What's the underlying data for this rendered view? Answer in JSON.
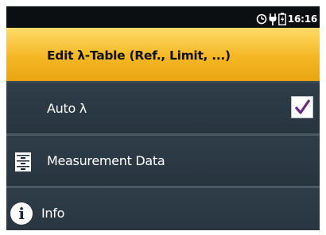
{
  "status": {
    "time": "16:16",
    "icons": [
      "timer-icon",
      "power-plug-icon",
      "battery-charging-icon"
    ]
  },
  "menu": {
    "items": [
      {
        "label": "Edit λ-Table (Ref., Limit, ...)",
        "selected": true
      },
      {
        "label": "Auto λ",
        "checked": true
      },
      {
        "label": "Measurement Data",
        "icon": "file-cabinet-icon"
      },
      {
        "label": "Info",
        "icon": "info-icon"
      }
    ]
  },
  "colors": {
    "highlight": "#f4b724",
    "item_bg": "#2b3944",
    "separator": "#4b5964"
  }
}
